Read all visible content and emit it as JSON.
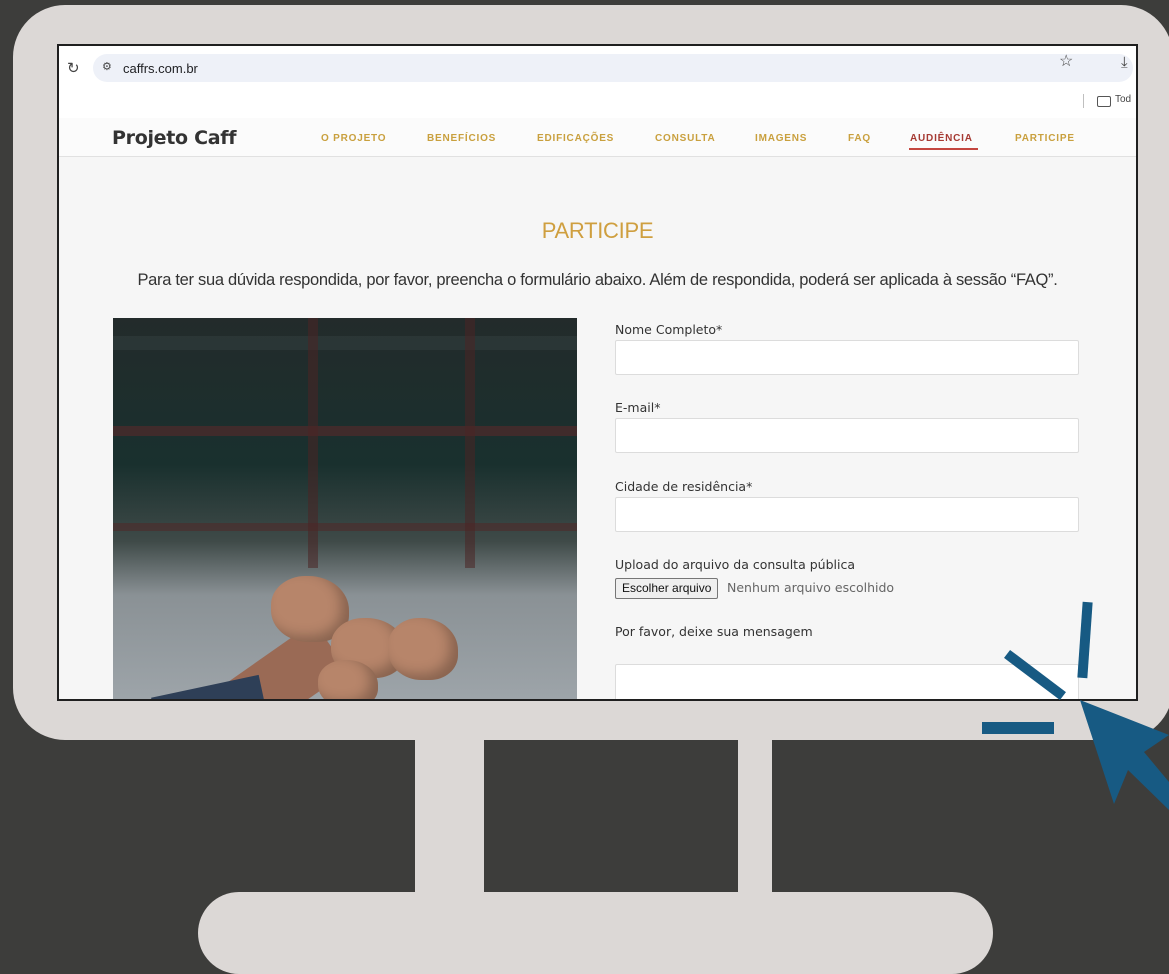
{
  "browser": {
    "url": "caffrs.com.br",
    "bookmark_label": "Tod"
  },
  "site": {
    "logo": "Projeto Caff",
    "nav": [
      {
        "label": "O PROJETO"
      },
      {
        "label": "BENEFÍCIOS"
      },
      {
        "label": "EDIFICAÇÕES"
      },
      {
        "label": "CONSULTA"
      },
      {
        "label": "IMAGENS"
      },
      {
        "label": "FAQ"
      },
      {
        "label": "AUDIÊNCIA",
        "active": true
      },
      {
        "label": "PARTICIPE"
      }
    ]
  },
  "section": {
    "title": "PARTICIPE",
    "intro": "Para ter sua dúvida respondida, por favor, preencha o formulário abaixo. Além de respondida, poderá ser aplicada à sessão “FAQ”."
  },
  "form": {
    "name_label": "Nome Completo*",
    "email_label": "E-mail*",
    "city_label": "Cidade de residência*",
    "upload_label": "Upload do arquivo da consulta pública",
    "file_button": "Escolher arquivo",
    "file_status": "Nenhum arquivo escolhido",
    "message_label": "Por favor, deixe sua mensagem"
  },
  "colors": {
    "nav": "#c9a03e",
    "nav_active": "#a63a33",
    "title": "#cf9f3f",
    "cursor": "#175a83",
    "monitor": "#dcd8d6",
    "background": "#3d3d3b"
  }
}
